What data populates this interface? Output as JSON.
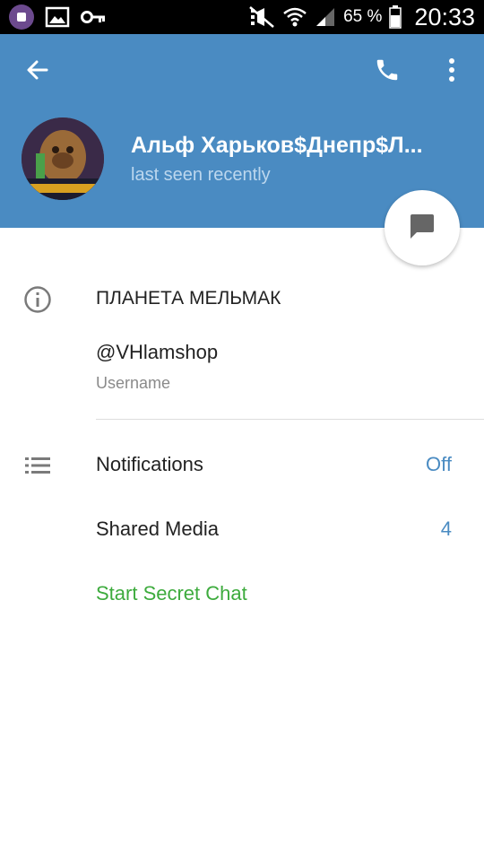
{
  "status_bar": {
    "battery_percent": "65 %",
    "time": "20:33",
    "icons": [
      "viber-app-icon",
      "gallery-icon",
      "key-icon",
      "mute-icon",
      "wifi-icon",
      "signal-icon",
      "battery-icon"
    ]
  },
  "header": {
    "contact_name": "Альф Харьков$Днепр$Л...",
    "status": "last seen recently",
    "icons": [
      "back-arrow-icon",
      "phone-icon",
      "more-vert-icon",
      "message-icon"
    ],
    "color": "#4a8bc2"
  },
  "profile": {
    "bio": "ПЛАНЕТА МЕЛЬМАК",
    "username": "@VHlamshop",
    "username_label": "Username"
  },
  "settings": {
    "notifications_label": "Notifications",
    "notifications_value": "Off",
    "shared_media_label": "Shared Media",
    "shared_media_value": "4",
    "secret_chat_label": "Start Secret Chat"
  },
  "colors": {
    "accent": "#4a8bc2",
    "secret_chat": "#3dab3d"
  }
}
